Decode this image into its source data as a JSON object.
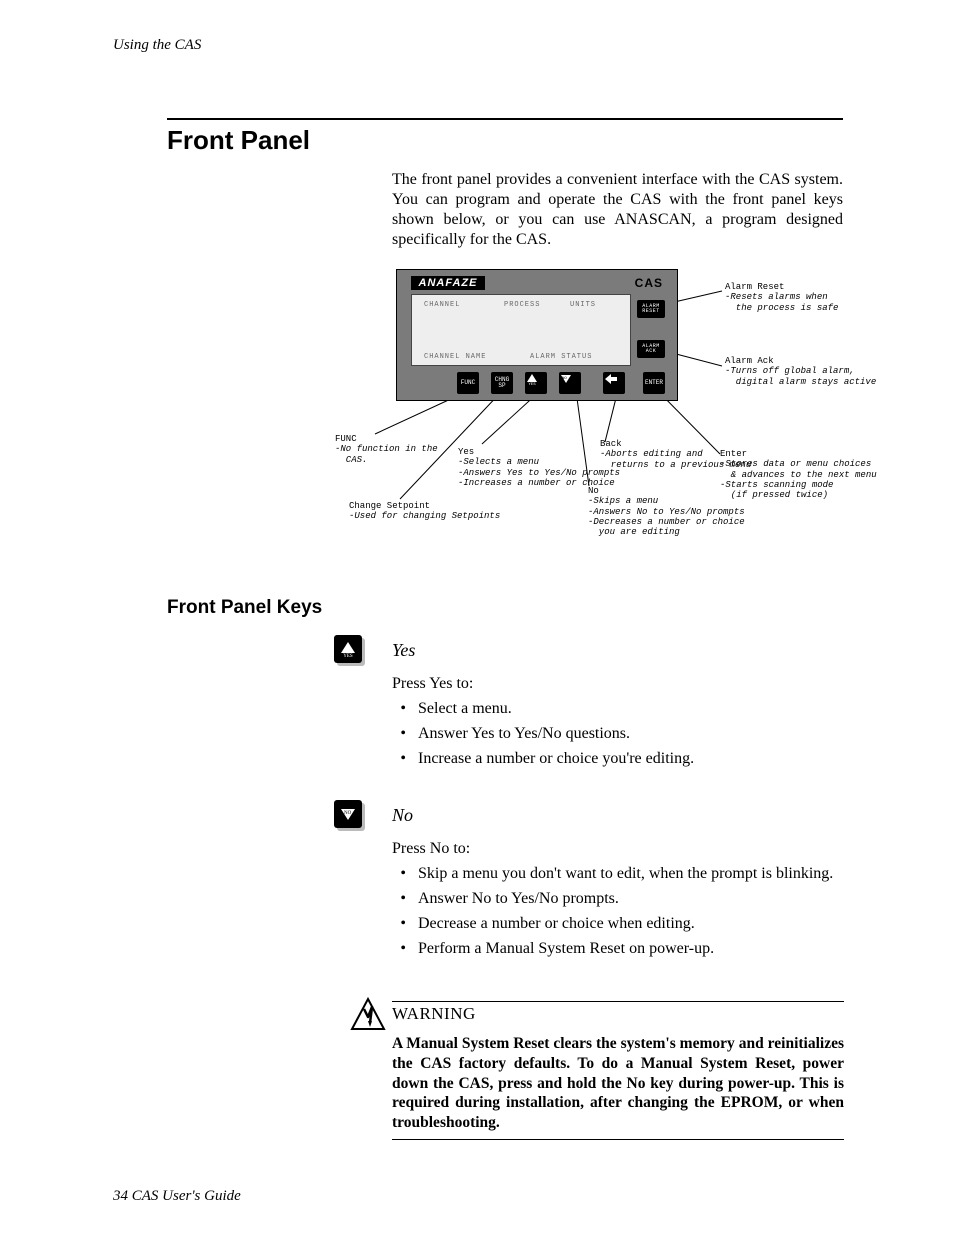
{
  "header": {
    "running": "Using the CAS"
  },
  "h1": "Front Panel",
  "intro": "The front panel provides a convenient interface with the CAS system. You can program and operate the CAS with the front panel keys shown below, or you can use ANASCAN, a program designed specifically for the CAS.",
  "panel": {
    "brand": "ANAFAZE",
    "model": "CAS",
    "lcd": {
      "channel": "CHANNEL",
      "process": "PROCESS",
      "units": "UNITS",
      "channel_name": "CHANNEL NAME",
      "alarm_status": "ALARM STATUS"
    },
    "buttons": {
      "alarm_reset": "ALARM\nRESET",
      "alarm_ack": "ALARM\nACK",
      "func": "FUNC",
      "chng_sp": "CHNG\nSP",
      "yes": "YES",
      "no": "NO",
      "back": "BACK",
      "enter": "ENTER"
    }
  },
  "captions": {
    "alarm_reset": {
      "title": "Alarm Reset",
      "desc": "-Resets alarms when\n  the process is safe"
    },
    "alarm_ack": {
      "title": "Alarm Ack",
      "desc": "-Turns off global alarm,\n  digital alarm stays active"
    },
    "enter": {
      "title": "Enter",
      "desc": "-Stores data or menu choices\n  & advances to the next menu\n-Starts scanning mode\n  (if pressed twice)"
    },
    "func": {
      "title": "FUNC",
      "desc": "-No function in the\n  CAS."
    },
    "chng_sp": {
      "title": "Change Setpoint",
      "desc": "-Used for changing Setpoints"
    },
    "yes": {
      "title": "Yes",
      "desc": "-Selects a menu\n-Answers Yes to Yes/No prompts\n-Increases a number or choice"
    },
    "back": {
      "title": "Back",
      "desc": "-Aborts editing and\n  returns to a previous menu"
    },
    "no": {
      "title": "No",
      "desc": "-Skips a menu\n-Answers No to Yes/No prompts\n-Decreases a number or choice\n  you are editing"
    }
  },
  "h2": "Front Panel Keys",
  "yes_section": {
    "title": "Yes",
    "lead": "Press Yes to:",
    "items": [
      "Select a menu.",
      "Answer Yes to Yes/No questions.",
      "Increase a number or choice you're editing."
    ]
  },
  "no_section": {
    "title": "No",
    "lead": "Press No to:",
    "items": [
      "Skip a menu you don't want to edit, when the prompt is blinking.",
      "Answer No to Yes/No prompts.",
      "Decrease a number or choice when editing.",
      "Perform a Manual System Reset on power-up."
    ]
  },
  "warning": {
    "title": "WARNING",
    "text": "A Manual System Reset clears the system's memory and reinitializes the CAS factory defaults. To do a Manual System Reset, power down the CAS, press and hold the No key during power-up. This is required during installation, after changing the EPROM, or when troubleshooting."
  },
  "footer": "34 CAS User's Guide"
}
